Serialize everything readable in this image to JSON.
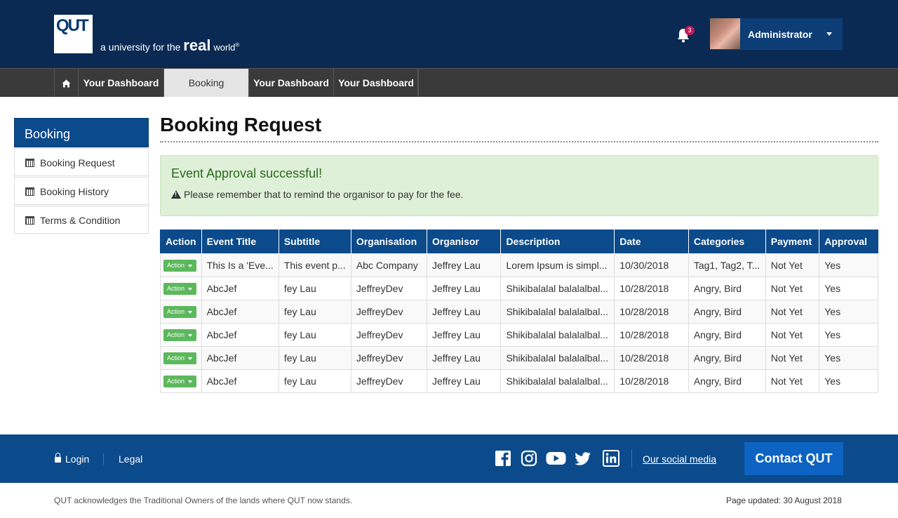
{
  "header": {
    "logo_text": "QUT",
    "tagline_prefix": "a university for the",
    "tagline_big": "real",
    "tagline_small": "world",
    "tagline_mark": "®",
    "notification_count": "3",
    "user_name": "Administrator"
  },
  "nav": {
    "items": [
      {
        "label": "Your Dashboard"
      },
      {
        "label": "Booking"
      },
      {
        "label": "Your Dashboard"
      },
      {
        "label": "Your Dashboard"
      }
    ]
  },
  "sidebar": {
    "title": "Booking",
    "items": [
      {
        "label": "Booking Request"
      },
      {
        "label": "Booking History"
      },
      {
        "label": "Terms & Condition"
      }
    ]
  },
  "main": {
    "title": "Booking Request",
    "alert_title": "Event Approval successful!",
    "alert_message": "Please remember that to remind the organisor to pay for the fee.",
    "table": {
      "columns": [
        "Action",
        "Event Title",
        "Subtitle",
        "Organisation",
        "Organisor",
        "Description",
        "Date",
        "Categories",
        "Payment",
        "Approval"
      ],
      "action_label": "Action",
      "rows": [
        [
          "This Is a 'Eve...",
          "This event p...",
          "Abc Company",
          "Jeffrey Lau",
          "Lorem Ipsum is simpl...",
          "10/30/2018",
          "Tag1, Tag2, T...",
          "Not Yet",
          "Yes"
        ],
        [
          "AbcJef",
          "fey Lau",
          "JeffreyDev",
          "Jeffrey Lau",
          "Shikibalalal balalalbal...",
          "10/28/2018",
          "Angry, Bird",
          "Not Yet",
          "Yes"
        ],
        [
          "AbcJef",
          "fey Lau",
          "JeffreyDev",
          "Jeffrey Lau",
          "Shikibalalal balalalbal...",
          "10/28/2018",
          "Angry, Bird",
          "Not Yet",
          "Yes"
        ],
        [
          "AbcJef",
          "fey Lau",
          "JeffreyDev",
          "Jeffrey Lau",
          "Shikibalalal balalalbal...",
          "10/28/2018",
          "Angry, Bird",
          "Not Yet",
          "Yes"
        ],
        [
          "AbcJef",
          "fey Lau",
          "JeffreyDev",
          "Jeffrey Lau",
          "Shikibalalal balalalbal...",
          "10/28/2018",
          "Angry, Bird",
          "Not Yet",
          "Yes"
        ],
        [
          "AbcJef",
          "fey Lau",
          "JeffreyDev",
          "Jeffrey Lau",
          "Shikibalalal balalalbal...",
          "10/28/2018",
          "Angry, Bird",
          "Not Yet",
          "Yes"
        ]
      ]
    }
  },
  "footer": {
    "login": "Login",
    "legal": "Legal",
    "social_link": "Our social media",
    "contact": "Contact QUT",
    "acknowledgement": "QUT acknowledges the Traditional Owners of the lands where QUT now stands.",
    "updated": "Page updated: 30 August 2018",
    "social_icons": [
      "facebook-icon",
      "instagram-icon",
      "youtube-icon",
      "twitter-icon",
      "linkedin-icon"
    ]
  }
}
